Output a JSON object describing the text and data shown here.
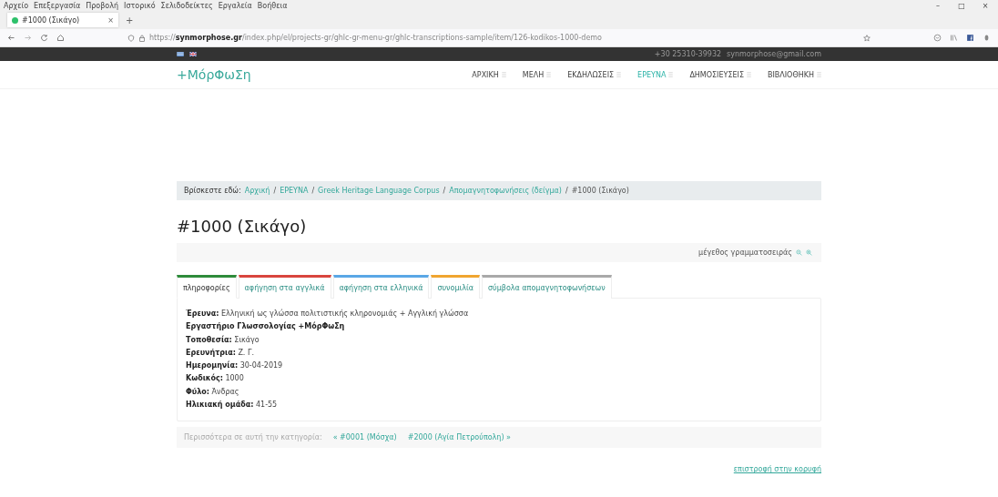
{
  "browser": {
    "menu": [
      "Αρχείο",
      "Επεξεργασία",
      "Προβολή",
      "Ιστορικό",
      "Σελιδοδείκτες",
      "Εργαλεία",
      "Βοήθεια"
    ],
    "tab": {
      "title": "#1000 (Σικάγο)",
      "close": "×",
      "new": "+"
    },
    "window_controls": [
      "–",
      "□",
      "×"
    ],
    "url": {
      "host": "synmorphose.gr",
      "prefix": "https://",
      "path": "/index.php/el/projects-gr/ghlc-gr-menu-gr/ghlc-transcriptions-sample/item/126-kodikos-1000-demo"
    }
  },
  "topbar": {
    "phone": "+30 25310-39932",
    "email": "synmorphose@gmail.com"
  },
  "logo": "+ΜόρΦωΣη",
  "nav": [
    {
      "label": "ΑΡΧΙΚΗ",
      "selected": false
    },
    {
      "label": "ΜΕΛΗ",
      "selected": false
    },
    {
      "label": "ΕΚΔΗΛΩΣΕΙΣ",
      "selected": false
    },
    {
      "label": "ΕΡΕΥΝΑ",
      "selected": true
    },
    {
      "label": "ΔΗΜΟΣΙΕΥΣΕΙΣ",
      "selected": false
    },
    {
      "label": "ΒΙΒΛΙΟΘΗΚΗ",
      "selected": false
    }
  ],
  "breadcrumb": {
    "label": "Βρίσκεστε εδώ:",
    "links": [
      "Αρχική",
      "ΕΡΕΥΝΑ",
      "Greek Heritage Language Corpus",
      "Απομαγνητοφωνήσεις (δείγμα)"
    ],
    "current": "#1000 (Σικάγο)",
    "separator": "/"
  },
  "title": "#1000 (Σικάγο)",
  "font_size_label": "μέγεθος γραμματοσειράς",
  "tabs": [
    {
      "label": "πληροφορίες",
      "selected": true,
      "color": "#2e8b3a"
    },
    {
      "label": "αφήγηση στα αγγλικά",
      "selected": false,
      "color": "#d9453e"
    },
    {
      "label": "αφήγηση στα ελληνικά",
      "selected": false,
      "color": "#5aa7e6"
    },
    {
      "label": "συνομιλία",
      "selected": false,
      "color": "#f0a530"
    },
    {
      "label": "σύμβολα απομαγνητοφωνήσεων",
      "selected": false,
      "color": "#a9a9a9"
    }
  ],
  "info": [
    {
      "text": "**Έρευνα:** Ελληνική ως γλώσσα πολιτιστικής κληρονομιάς + Αγγλική γλώσσα"
    },
    {
      "text": "**Εργαστήριο Γλωσσολογίας +ΜόρΦωΣη**"
    },
    {
      "text": "**Τοποθεσία:** Σικάγο"
    },
    {
      "text": "**Ερευνήτρια:** Ζ. Γ."
    },
    {
      "text": "**Ημερομηνία:** 30-04-2019"
    },
    {
      "text": "**Κωδικός:** 1000"
    },
    {
      "text": "**Φύλο:** Άνδρας"
    },
    {
      "text": "**Ηλικιακή ομάδα:** 41-55"
    }
  ],
  "more": {
    "label": "Περισσότερα σε αυτή την κατηγορία:",
    "prev": "« #0001 (Μόσχα)",
    "next": "#2000 (Αγία Πετρούπολη) »"
  },
  "back_to_top": "επιστροφή στην κορυφή"
}
